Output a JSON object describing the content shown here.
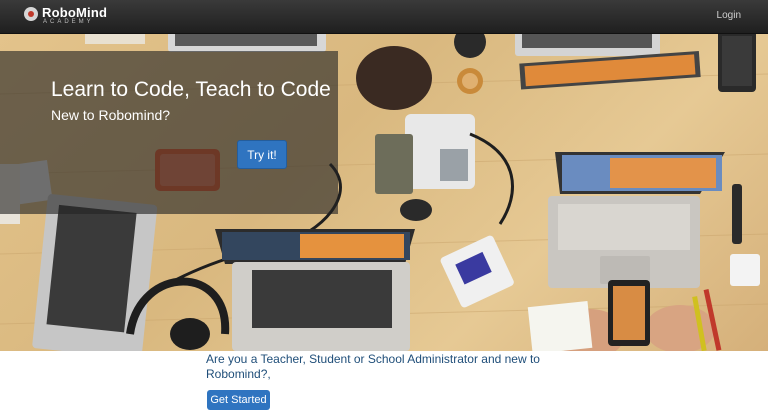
{
  "navbar": {
    "logo_name": "RoboMind",
    "logo_sub": "ACADEMY",
    "login_label": "Login"
  },
  "hero": {
    "title": "Learn to Code, Teach to Code",
    "subtitle": "New to Robomind?",
    "try_label": "Try it!"
  },
  "main": {
    "question": "Are you a Teacher, Student or School Administrator and new to Robomind?,",
    "cta_label": "Get Started"
  },
  "colors": {
    "navbar": "#2a2a2a",
    "accent": "#2f74c0",
    "question_text": "#1f4e79"
  }
}
